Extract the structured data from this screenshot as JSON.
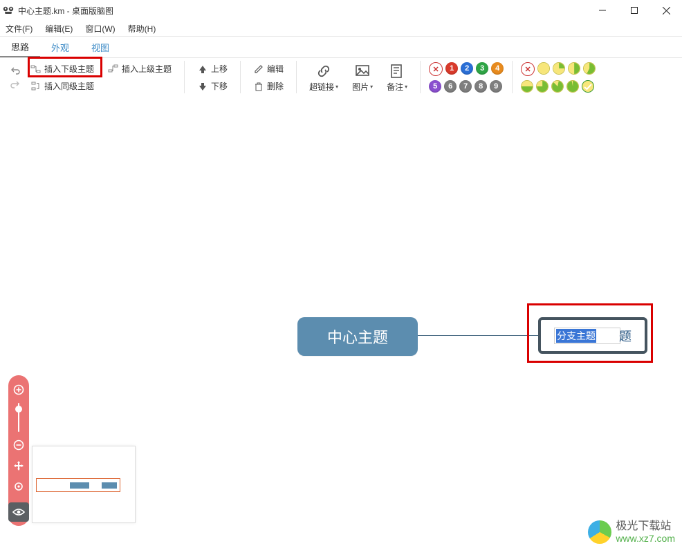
{
  "window": {
    "title": "中心主题.km - 桌面版脑图"
  },
  "menubar": {
    "file": "文件(F)",
    "edit": "编辑(E)",
    "window": "窗口(W)",
    "help": "帮助(H)"
  },
  "tabs": {
    "mind": "思路",
    "appearance": "外观",
    "view": "视图"
  },
  "toolbar": {
    "insert_child": "插入下级主题",
    "insert_sibling": "插入同级主题",
    "insert_parent": "插入上级主题",
    "move_up": "上移",
    "move_down": "下移",
    "edit": "编辑",
    "delete": "删除",
    "link": "超链接",
    "image": "图片",
    "note": "备注",
    "priority_clear": "✕",
    "priority_labels": [
      "1",
      "2",
      "3",
      "4",
      "5",
      "6",
      "7",
      "8",
      "9"
    ],
    "progress_clear": "✕"
  },
  "canvas": {
    "center_label": "中心主题",
    "child_input_selected": "分支主题",
    "child_input_suffix": "题"
  },
  "watermark": {
    "line1": "极光下载站",
    "line2": "www.xz7.com"
  }
}
